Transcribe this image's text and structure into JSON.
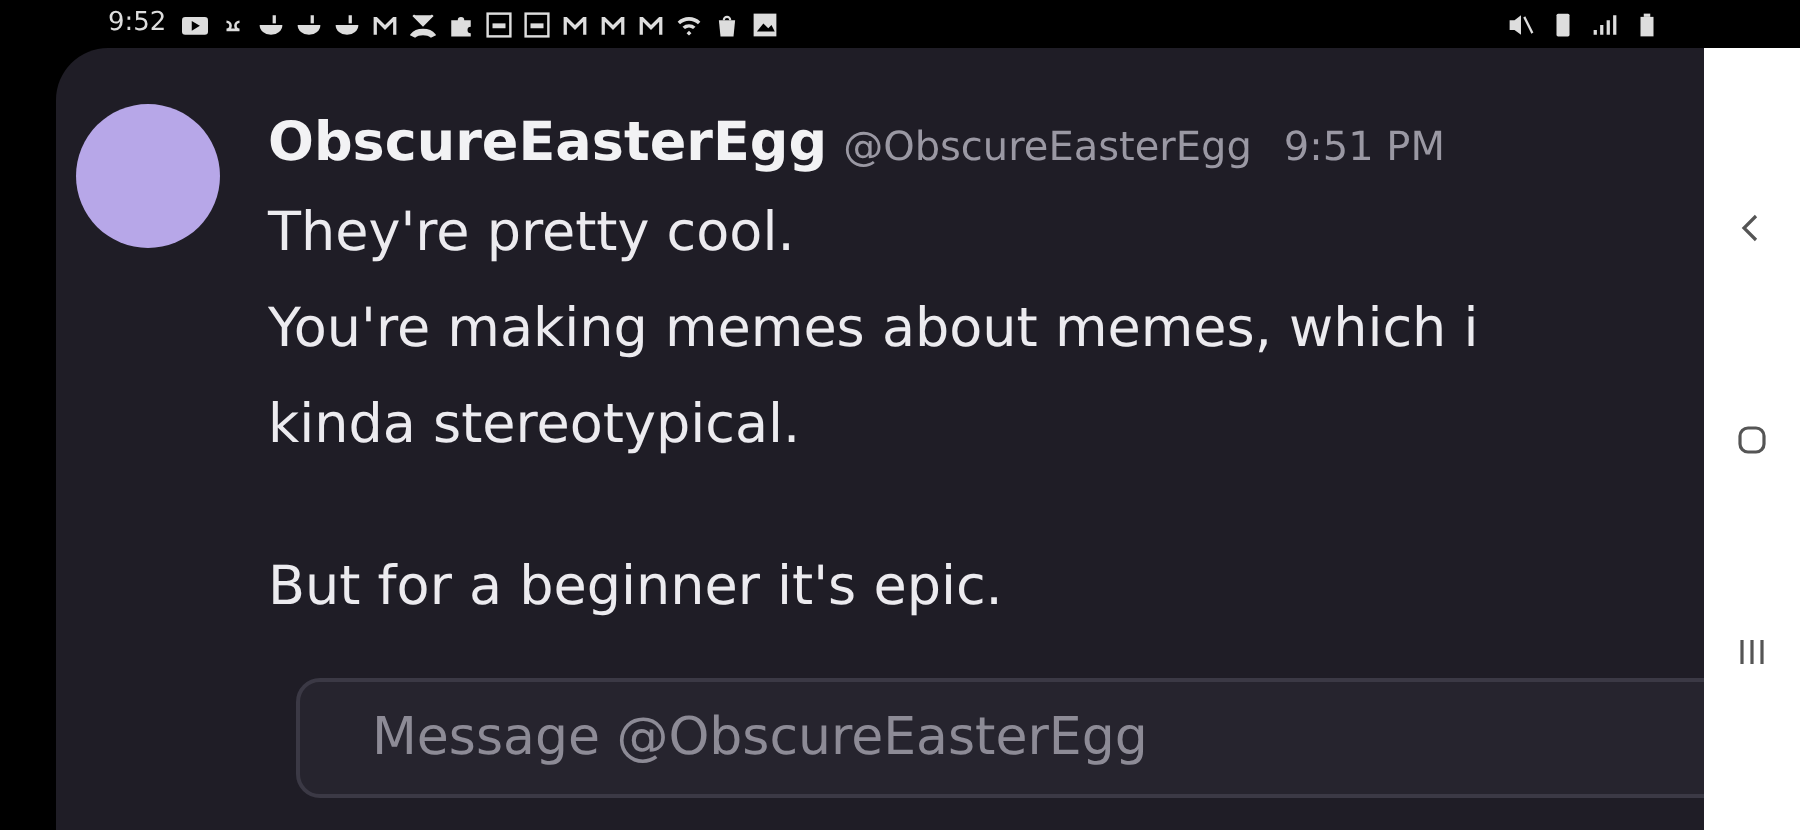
{
  "status_bar": {
    "time": "9:52"
  },
  "message": {
    "author": "ObscureEasterEgg",
    "handle": "@ObscureEasterEgg",
    "time": "9:51 PM",
    "paragraphs": [
      [
        "They're pretty cool.",
        "You're making memes about memes, which i",
        "kinda stereotypical."
      ],
      [
        "But for a beginner it's epic."
      ]
    ]
  },
  "composer": {
    "placeholder": "Message @ObscureEasterEgg"
  }
}
